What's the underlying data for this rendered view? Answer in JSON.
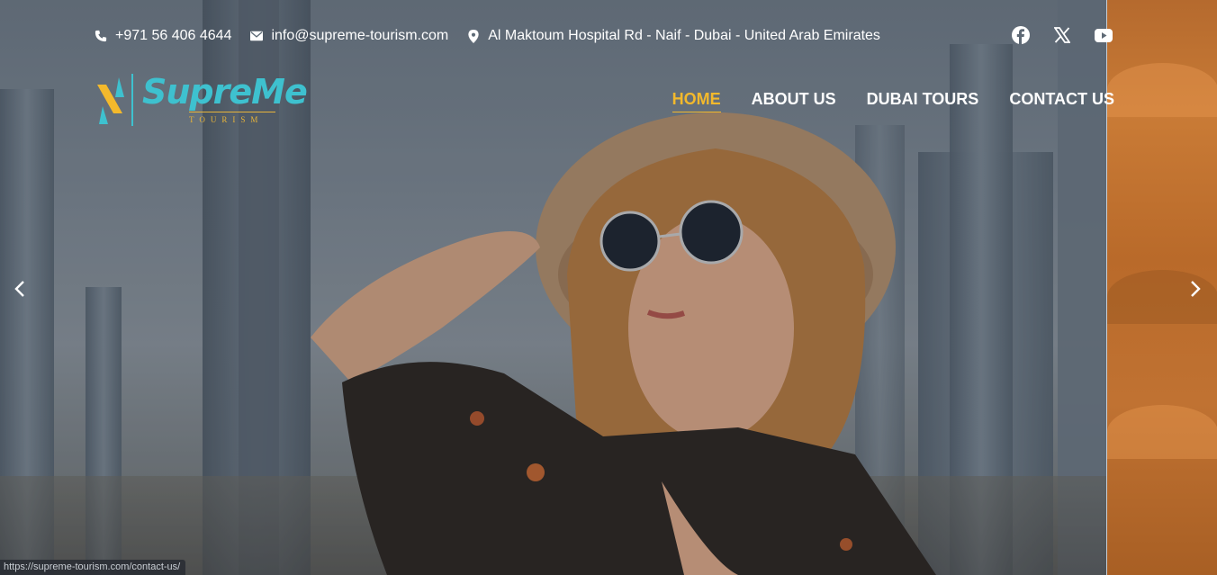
{
  "topbar": {
    "phone": "+971 56 406 4644",
    "email": "info@supreme-tourism.com",
    "address": "Al Maktoum Hospital Rd - Naif - Dubai - United Arab Emirates"
  },
  "logo": {
    "name": "SupreMe",
    "tagline": "TOURISM"
  },
  "nav": [
    {
      "label": "HOME",
      "active": true
    },
    {
      "label": "ABOUT US",
      "active": false
    },
    {
      "label": "DUBAI TOURS",
      "active": false
    },
    {
      "label": "CONTACT US",
      "active": false
    }
  ],
  "social": [
    "facebook-icon",
    "x-icon",
    "youtube-icon"
  ],
  "slider": {
    "prev_icon": "chevron-left-icon",
    "next_icon": "chevron-right-icon"
  },
  "status_url": "https://supreme-tourism.com/contact-us/",
  "colors": {
    "accent": "#f3b92c",
    "brand_teal": "#3ec1cf",
    "text": "#ffffff"
  }
}
